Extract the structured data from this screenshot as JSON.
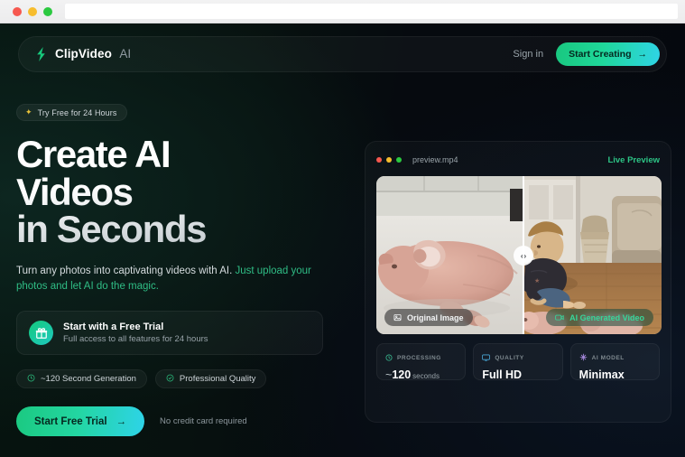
{
  "browser": {
    "lights": [
      "close",
      "minimize",
      "maximize"
    ],
    "url": ""
  },
  "nav": {
    "logo_icon": "lightning-bolt-icon",
    "brand": "ClipVideo",
    "brand_suffix": "AI",
    "signin": "Sign in",
    "cta": "Start Creating",
    "cta_arrow": "→"
  },
  "hero": {
    "badge": "Try Free for 24 Hours",
    "badge_icon": "sparkle-icon",
    "headline_lines": [
      "Create AI",
      "Videos",
      "in Seconds"
    ],
    "sub_plain": "Turn any photos into captivating videos with AI. ",
    "sub_highlight": "Just upload your photos and let AI do the magic.",
    "trial_card": {
      "icon": "gift-icon",
      "title": "Start with a Free Trial",
      "subtitle": "Full access to all features for 24 hours"
    },
    "chips": [
      {
        "icon": "clock-icon",
        "label": "~120 Second Generation"
      },
      {
        "icon": "check-circle-icon",
        "label": "Professional Quality"
      }
    ],
    "cta": "Start Free Trial",
    "cta_arrow": "→",
    "note": "No credit card required"
  },
  "preview": {
    "filename": "preview.mp4",
    "live_label": "Live Preview",
    "handle_left": "‹",
    "handle_right": "›",
    "original_label": "Original Image",
    "original_icon": "image-icon",
    "generated_label": "AI Generated Video",
    "generated_icon": "video-camera-icon",
    "stats": [
      {
        "icon": "clock-icon",
        "label": "PROCESSING",
        "tilde": "~",
        "value": "120",
        "unit": "seconds"
      },
      {
        "icon": "monitor-icon",
        "label": "QUALITY",
        "tilde": "",
        "value": "Full HD",
        "unit": ""
      },
      {
        "icon": "sparkle-icon",
        "label": "AI MODEL",
        "tilde": "",
        "value": "Minimax",
        "unit": ""
      }
    ]
  },
  "colors": {
    "accent_green": "#1bc981",
    "accent_cyan": "#2ed3e8",
    "live_green": "#2dc486",
    "badge_gold": "#e8c23a",
    "page_bg": "#06140f"
  }
}
